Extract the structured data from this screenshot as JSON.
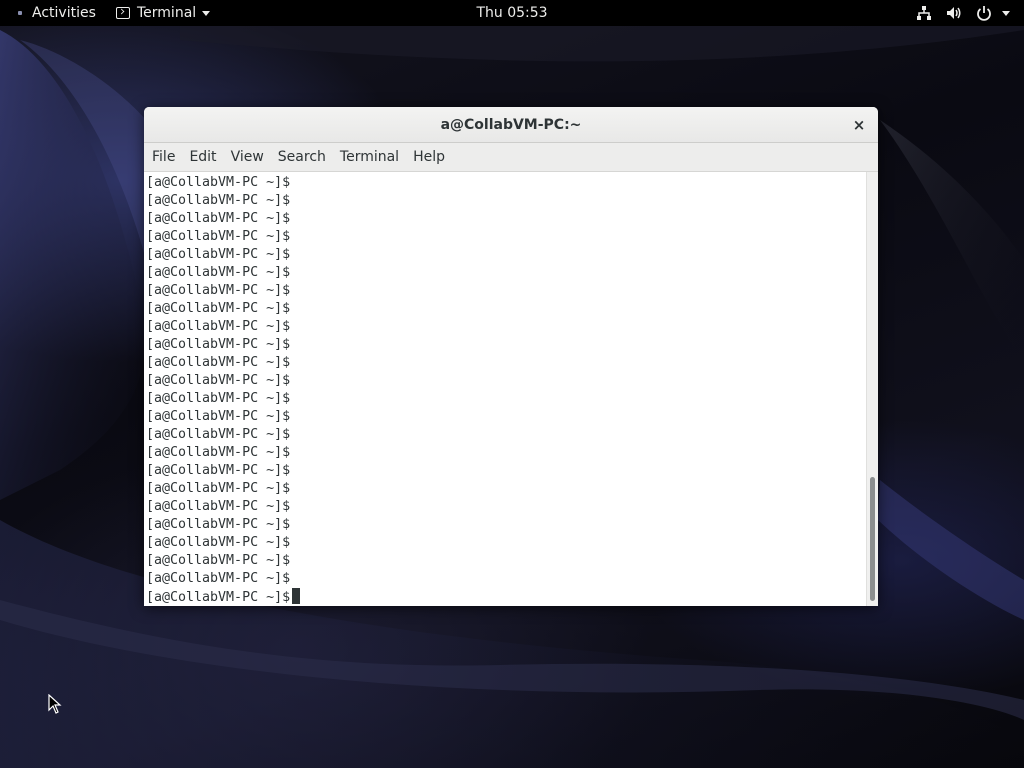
{
  "topbar": {
    "activities_label": "Activities",
    "app_menu_label": "Terminal",
    "clock": "Thu 05:53",
    "status_icons": [
      "network-icon",
      "volume-icon",
      "power-icon"
    ]
  },
  "window": {
    "title": "a@CollabVM-PC:~",
    "close_glyph": "×",
    "menu": {
      "file": "File",
      "edit": "Edit",
      "view": "View",
      "search": "Search",
      "terminal": "Terminal",
      "help": "Help"
    },
    "prompt_lines": [
      "[a@CollabVM-PC ~]$",
      "[a@CollabVM-PC ~]$",
      "[a@CollabVM-PC ~]$",
      "[a@CollabVM-PC ~]$",
      "[a@CollabVM-PC ~]$",
      "[a@CollabVM-PC ~]$",
      "[a@CollabVM-PC ~]$",
      "[a@CollabVM-PC ~]$",
      "[a@CollabVM-PC ~]$",
      "[a@CollabVM-PC ~]$",
      "[a@CollabVM-PC ~]$",
      "[a@CollabVM-PC ~]$",
      "[a@CollabVM-PC ~]$",
      "[a@CollabVM-PC ~]$",
      "[a@CollabVM-PC ~]$",
      "[a@CollabVM-PC ~]$",
      "[a@CollabVM-PC ~]$",
      "[a@CollabVM-PC ~]$",
      "[a@CollabVM-PC ~]$",
      "[a@CollabVM-PC ~]$",
      "[a@CollabVM-PC ~]$",
      "[a@CollabVM-PC ~]$",
      "[a@CollabVM-PC ~]$",
      "[a@CollabVM-PC ~]$"
    ]
  },
  "colors": {
    "topbar_bg": "#000000",
    "terminal_text": "#2e3436",
    "terminal_bg": "#ffffff"
  }
}
